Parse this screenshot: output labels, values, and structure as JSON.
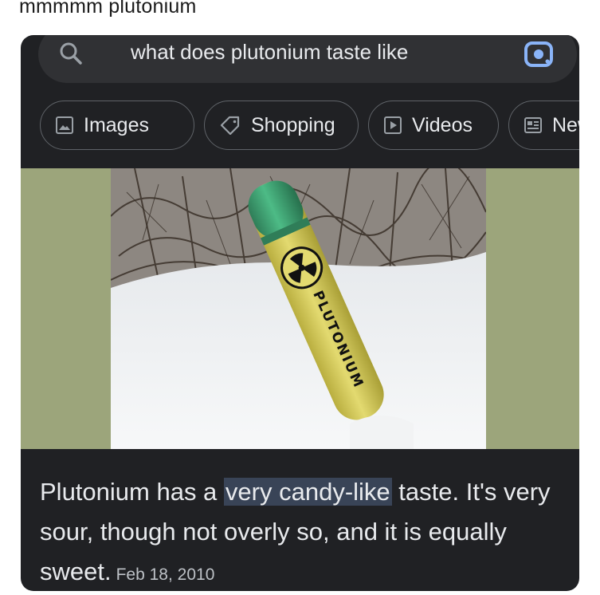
{
  "post": {
    "caption": "mmmmm plutonium"
  },
  "search": {
    "query": "what does plutonium taste like",
    "left_icon": "search-icon",
    "right_icon": "google-lens-icon"
  },
  "chips": [
    {
      "label": "Images",
      "icon": "image-icon"
    },
    {
      "label": "Shopping",
      "icon": "tag-icon"
    },
    {
      "label": "Videos",
      "icon": "play-icon"
    },
    {
      "label": "New",
      "icon": "news-icon"
    }
  ],
  "image": {
    "tube_label": "PLUTONIUM",
    "symbol": "radiation-trefoil"
  },
  "answer": {
    "before": "Plutonium has a ",
    "highlight": "very candy-like",
    "after": " taste. It's very sour, though not overly so, and it is equally sweet.",
    "date": "Feb 18, 2010"
  },
  "colors": {
    "card_bg": "#202124",
    "searchbar_bg": "#303134",
    "text": "#e8eaed",
    "highlight_bg": "#394457",
    "side_panel": "#9ca57b",
    "tube_yellow": "#d9cf5e",
    "tube_cap": "#3a9a6c"
  }
}
